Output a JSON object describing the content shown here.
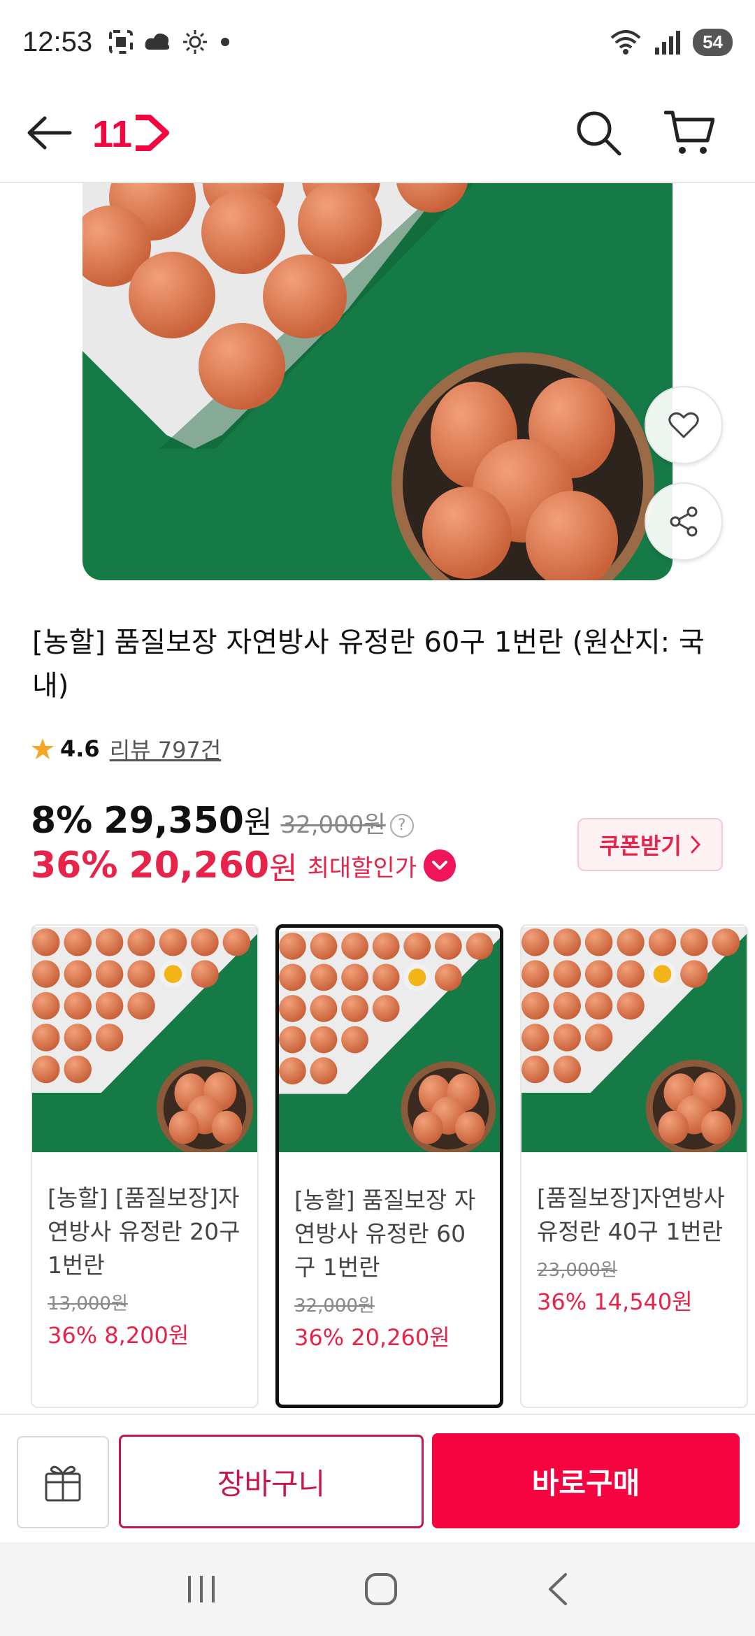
{
  "status_bar": {
    "time": "12:53",
    "battery": "54",
    "icons": [
      "screenshot-icon",
      "cloud-icon",
      "brightness-icon",
      "dot-icon",
      "wifi-icon",
      "signal-icon"
    ]
  },
  "app_bar": {
    "logo_text": "11",
    "icons": [
      "back-arrow-icon",
      "search-icon",
      "cart-icon"
    ]
  },
  "product": {
    "title": "[농할] 품질보장 자연방사 유정란 60구 1번란 (원산지: 국내)",
    "rating": "4.6",
    "reviews": "리뷰 797건",
    "price_row1": {
      "discount": "8%",
      "price": "29,350",
      "won": "원",
      "original": "32,000원",
      "help": "?"
    },
    "price_row2": {
      "discount": "36%",
      "price": "20,260",
      "won": "원",
      "label": "최대할인가"
    },
    "coupon_label": "쿠폰받기"
  },
  "options": [
    {
      "name": "[농할] [품질보장]자연방사 유정란 20구 1번란",
      "original": "13,000원",
      "sale": "36% 8,200원",
      "selected": false
    },
    {
      "name": "[농할] 품질보장 자연방사 유정란 60구 1번란",
      "original": "32,000원",
      "sale": "36% 20,260원",
      "selected": true
    },
    {
      "name": "[품질보장]자연방사 유정란 40구 1번란",
      "original": "23,000원",
      "sale": "36% 14,540원",
      "selected": false
    }
  ],
  "bottom_bar": {
    "cart_label": "장바구니",
    "buy_label": "바로구매"
  },
  "colors": {
    "accent": "#f5043f",
    "sale_text": "#e8234a",
    "egg": "#e07a52",
    "background_green": "#157a45"
  }
}
